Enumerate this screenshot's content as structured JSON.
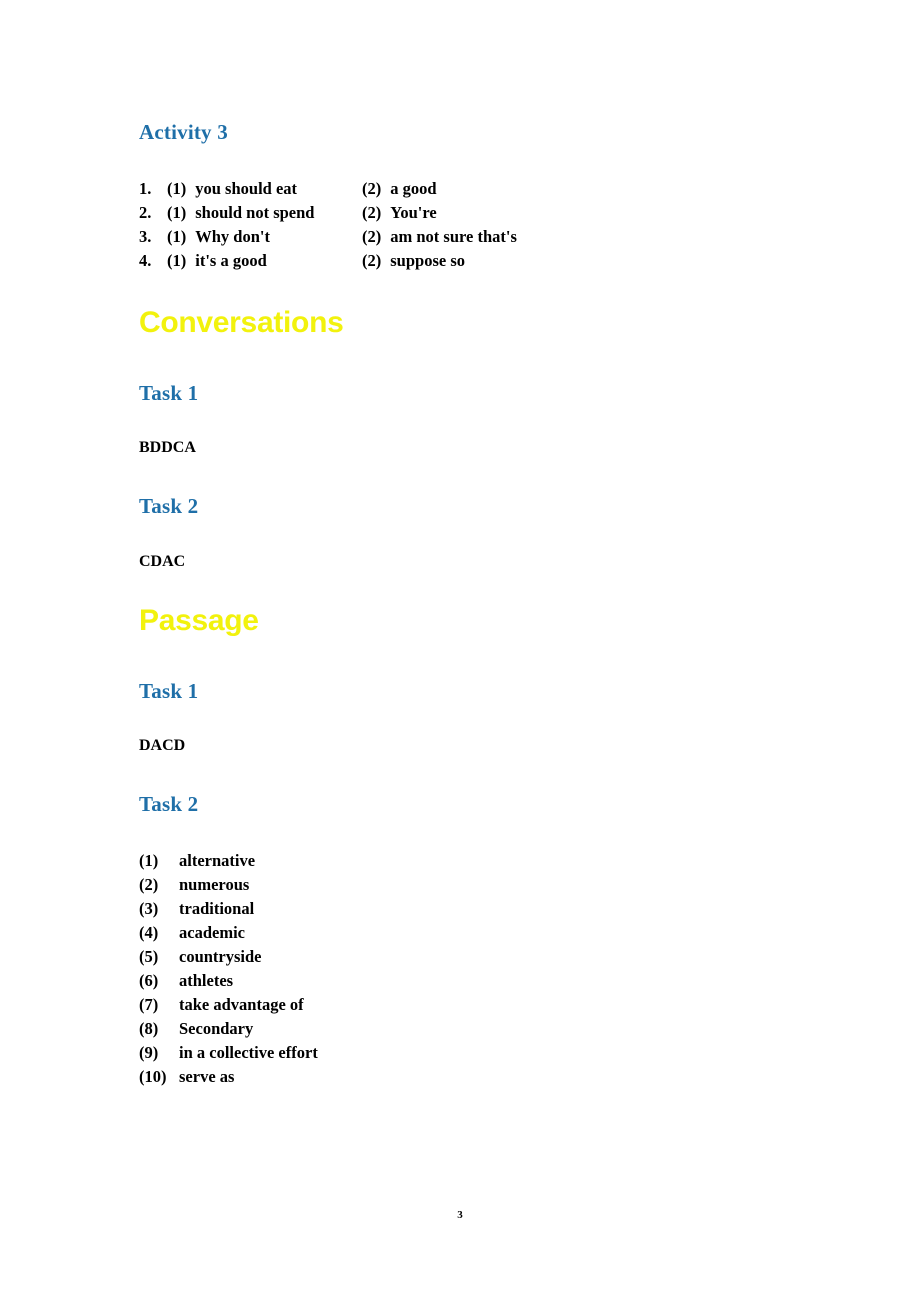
{
  "document": {
    "page_number": "3",
    "colors": {
      "heading_blue": "#1F6FA8",
      "heading_yellow": "#F2F20D",
      "body_text": "#000000",
      "background": "#FFFFFF"
    }
  },
  "sections": {
    "activity3": {
      "heading": "Activity 3",
      "rows": [
        {
          "num": "1.",
          "p1": "(1)",
          "a1": "you should eat",
          "p2": "(2)",
          "a2": "a good"
        },
        {
          "num": "2.",
          "p1": "(1)",
          "a1": "should not spend",
          "p2": "(2)",
          "a2": "You're"
        },
        {
          "num": "3.",
          "p1": "(1)",
          "a1": "Why don't",
          "p2": "(2)",
          "a2": "am not sure that's"
        },
        {
          "num": "4.",
          "p1": "(1)",
          "a1": "it's a good",
          "p2": "(2)",
          "a2": "suppose so"
        }
      ]
    },
    "conversations": {
      "heading": "Conversations",
      "task1": {
        "heading": "Task 1",
        "answer": "BDDCA"
      },
      "task2": {
        "heading": "Task 2",
        "answer": "CDAC"
      }
    },
    "passage": {
      "heading": "Passage",
      "task1": {
        "heading": "Task 1",
        "answer": "DACD"
      },
      "task2": {
        "heading": "Task 2",
        "items": [
          {
            "num": "(1)",
            "word": "alternative"
          },
          {
            "num": "(2)",
            "word": "numerous"
          },
          {
            "num": "(3)",
            "word": "traditional"
          },
          {
            "num": "(4)",
            "word": "academic"
          },
          {
            "num": "(5)",
            "word": "countryside"
          },
          {
            "num": "(6)",
            "word": "athletes"
          },
          {
            "num": "(7)",
            "word": "take advantage of"
          },
          {
            "num": "(8)",
            "word": "Secondary"
          },
          {
            "num": "(9)",
            "word": "in a collective effort"
          },
          {
            "num": "(10)",
            "word": "serve as"
          }
        ]
      }
    }
  }
}
